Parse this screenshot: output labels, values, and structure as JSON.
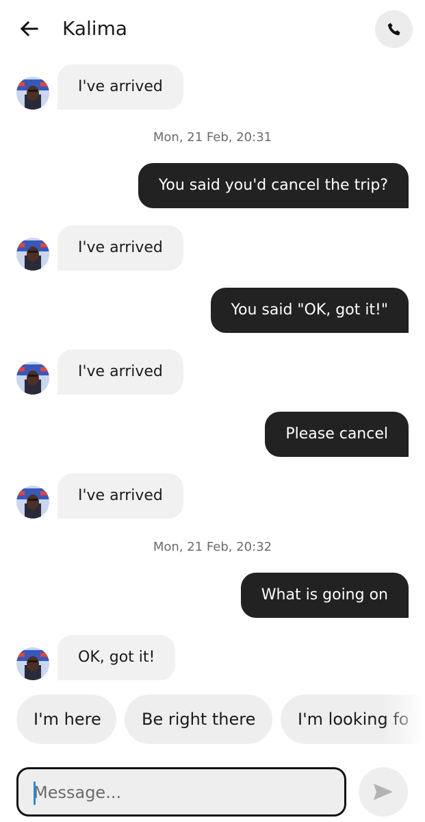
{
  "header": {
    "back_icon": "arrow-left-icon",
    "contact_name": "Kalima",
    "call_icon": "phone-icon"
  },
  "messages": [
    {
      "type": "incoming",
      "text": "I've arrived"
    },
    {
      "type": "timestamp",
      "text": "Mon, 21 Feb, 20:31"
    },
    {
      "type": "outgoing",
      "text": "You said you'd cancel the trip?"
    },
    {
      "type": "incoming",
      "text": "I've arrived"
    },
    {
      "type": "outgoing",
      "text": "You said \"OK, got it!\""
    },
    {
      "type": "incoming",
      "text": "I've arrived"
    },
    {
      "type": "outgoing",
      "text": "Please cancel"
    },
    {
      "type": "incoming",
      "text": "I've arrived"
    },
    {
      "type": "timestamp",
      "text": "Mon, 21 Feb, 20:32"
    },
    {
      "type": "outgoing",
      "text": "What is going on"
    },
    {
      "type": "incoming",
      "text": "OK, got it!"
    }
  ],
  "quick_replies": [
    "I'm here",
    "Be right there",
    "I'm looking fo"
  ],
  "composer": {
    "placeholder": "Message...",
    "send_icon": "send-icon"
  },
  "colors": {
    "outgoing_bubble": "#222222",
    "incoming_bubble": "#f1f1f1",
    "chip_background": "#eeeeee",
    "caret": "#2a8ad6"
  }
}
